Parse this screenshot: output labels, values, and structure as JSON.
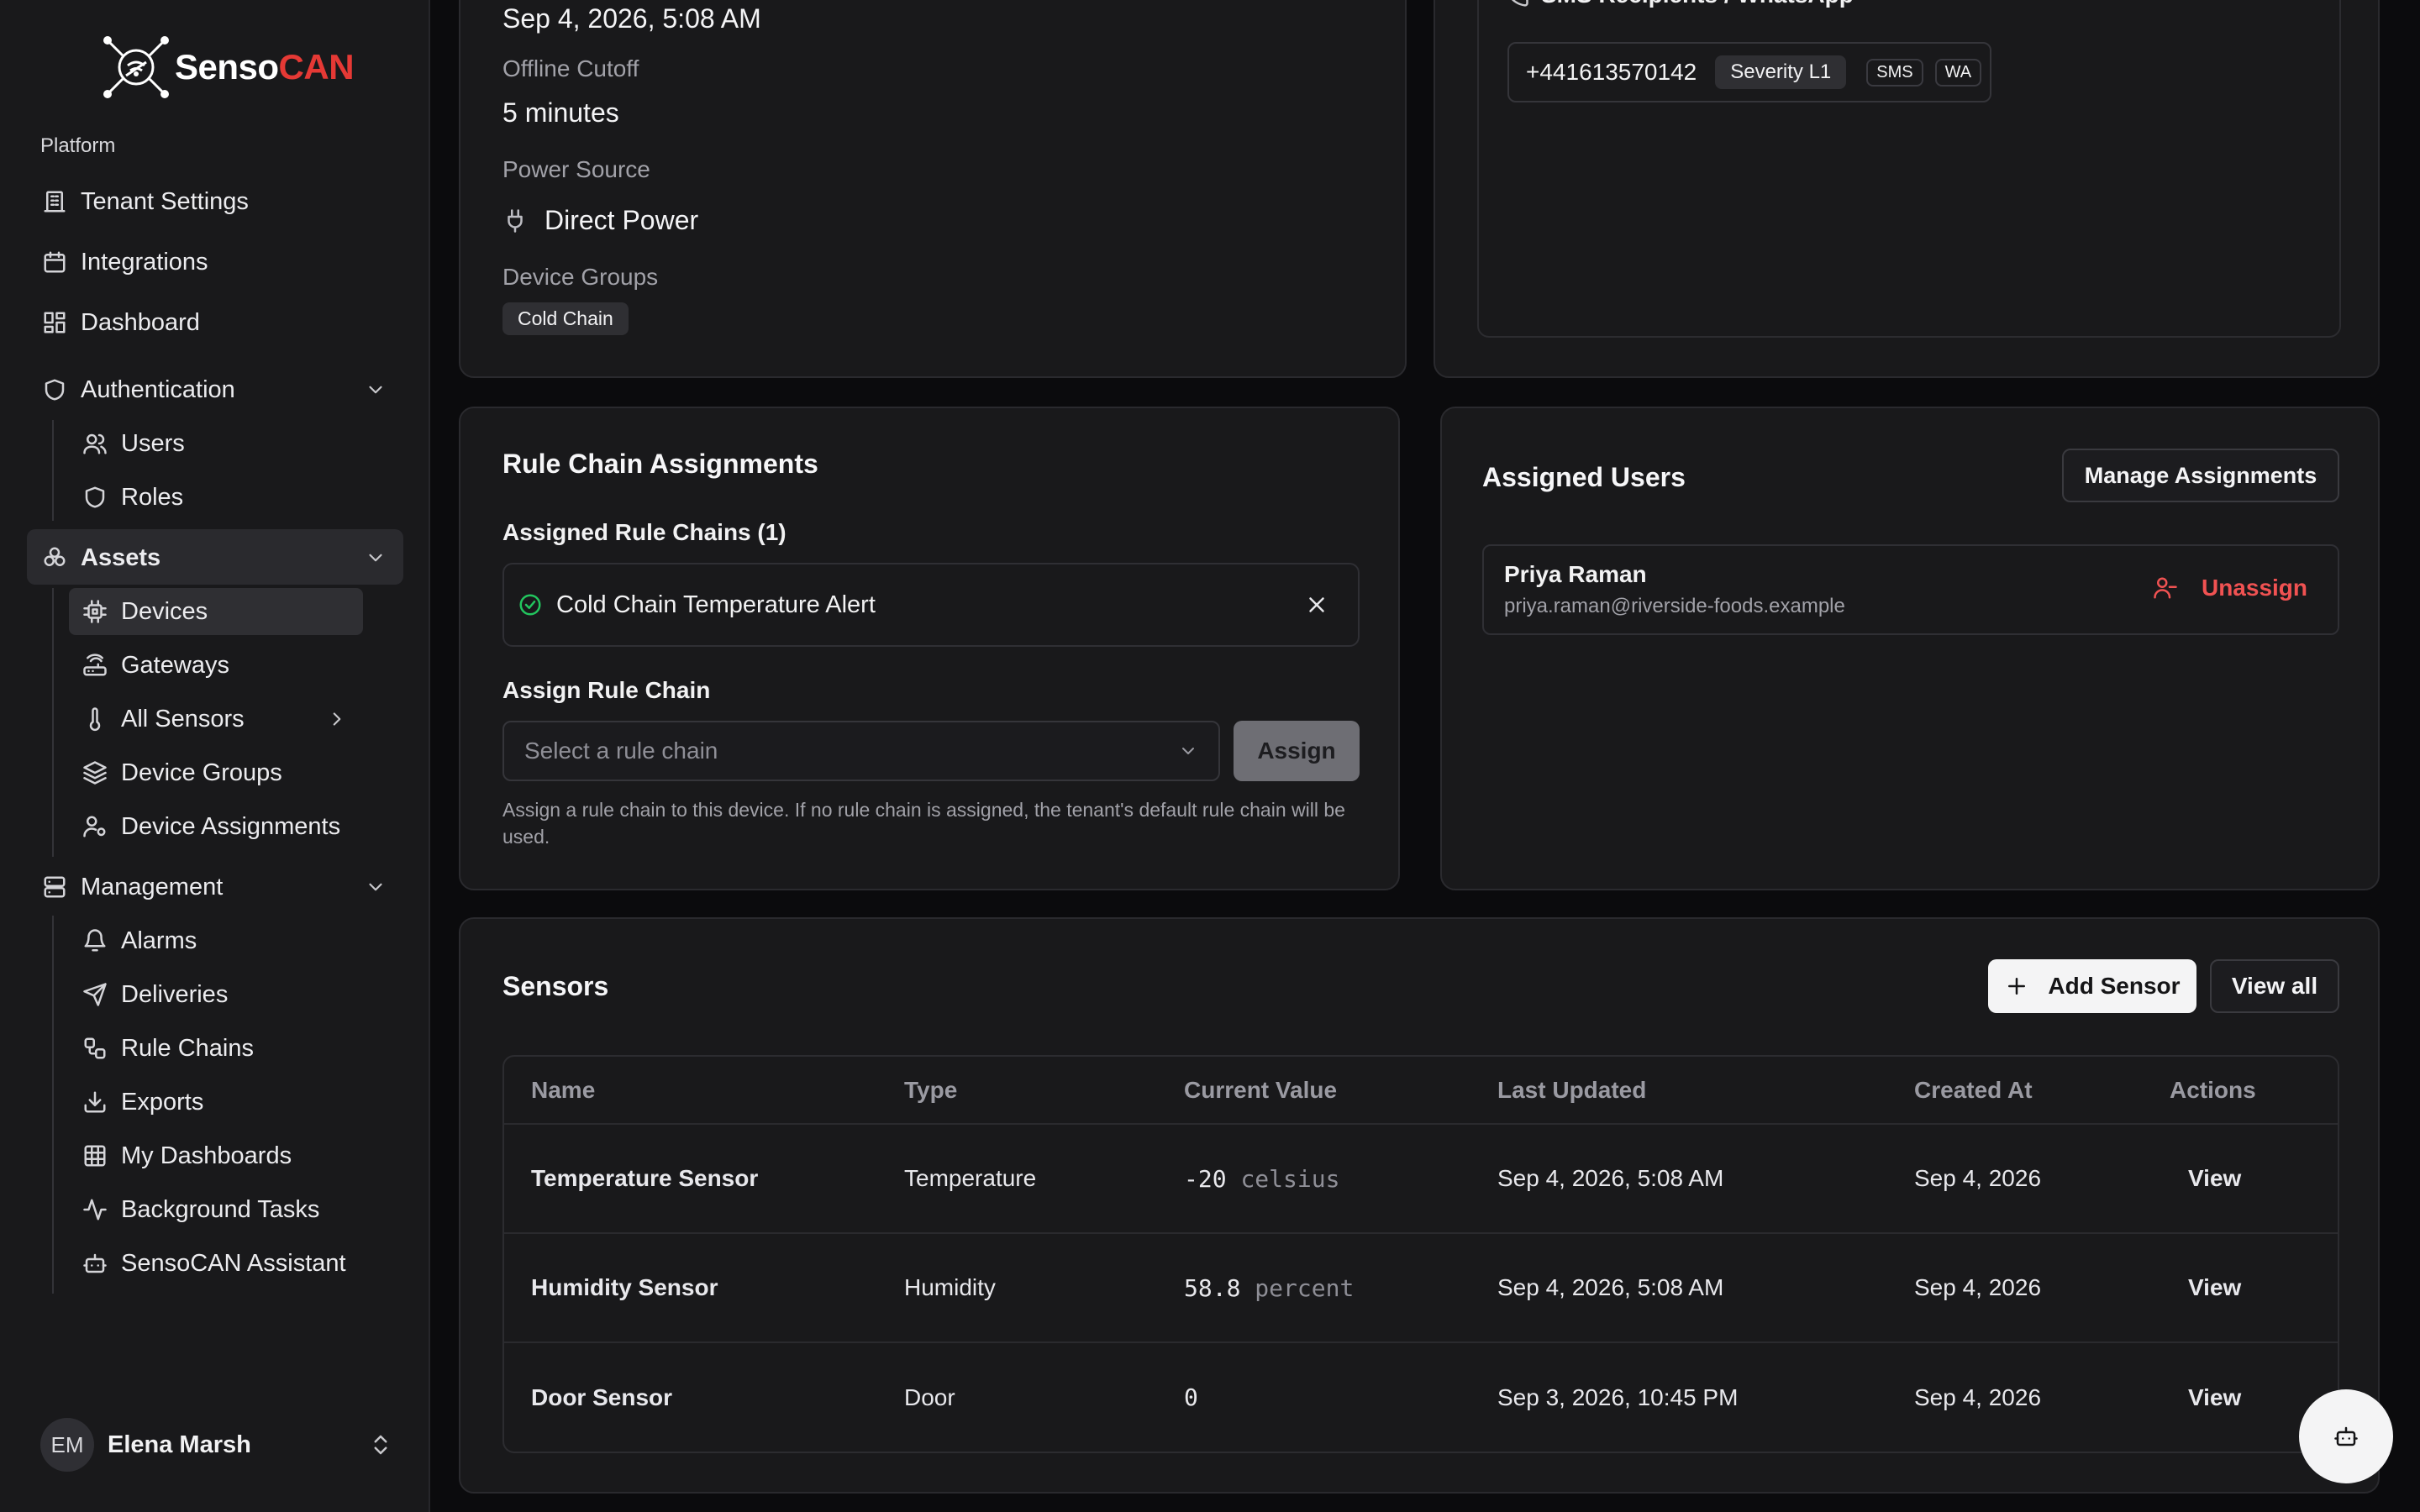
{
  "app": {
    "brand_part1": "Senso",
    "brand_part2": "CAN",
    "brand_colors": {
      "primary": "#ffffff",
      "accent": "#e53935"
    }
  },
  "sidebar": {
    "section_label": "Platform",
    "items": [
      {
        "label": "Tenant Settings",
        "icon": "building-icon"
      },
      {
        "label": "Integrations",
        "icon": "calendar-icon"
      },
      {
        "label": "Dashboard",
        "icon": "dashboard-icon"
      },
      {
        "label": "Authentication",
        "icon": "shield-icon",
        "expanded": true
      },
      {
        "label": "Users",
        "icon": "users-icon"
      },
      {
        "label": "Roles",
        "icon": "shield-icon"
      },
      {
        "label": "Assets",
        "icon": "assets-icon",
        "expanded": true,
        "active": true
      },
      {
        "label": "Devices",
        "icon": "chip-icon",
        "active": true
      },
      {
        "label": "Gateways",
        "icon": "router-icon"
      },
      {
        "label": "All Sensors",
        "icon": "thermometer-icon"
      },
      {
        "label": "Device Groups",
        "icon": "layers-icon"
      },
      {
        "label": "Device Assignments",
        "icon": "user-cog-icon"
      },
      {
        "label": "Management",
        "icon": "server-icon",
        "expanded": true
      },
      {
        "label": "Alarms",
        "icon": "bell-icon"
      },
      {
        "label": "Deliveries",
        "icon": "send-icon"
      },
      {
        "label": "Rule Chains",
        "icon": "workflow-icon"
      },
      {
        "label": "Exports",
        "icon": "download-icon"
      },
      {
        "label": "My Dashboards",
        "icon": "grid-icon"
      },
      {
        "label": "Background Tasks",
        "icon": "activity-icon"
      },
      {
        "label": "SensoCAN Assistant",
        "icon": "bot-icon"
      }
    ],
    "user": {
      "initials": "EM",
      "name": "Elena Marsh"
    }
  },
  "device_info": {
    "last_seen_value": "Sep 4, 2026, 5:08 AM",
    "offline_cutoff_label": "Offline Cutoff",
    "offline_cutoff_value": "5 minutes",
    "power_source_label": "Power Source",
    "power_source_value": "Direct Power",
    "device_groups_label": "Device Groups",
    "device_groups": [
      "Cold Chain"
    ]
  },
  "notifications": {
    "sms_header": "SMS Recipients / WhatsApp",
    "recipient": {
      "phone": "+441613570142",
      "severity": "Severity L1",
      "channels": [
        "SMS",
        "WA"
      ]
    }
  },
  "rule_chains": {
    "title": "Rule Chain Assignments",
    "assigned_label": "Assigned Rule Chains (1)",
    "assigned": [
      {
        "name": "Cold Chain Temperature Alert",
        "status_color": "#22c55e"
      }
    ],
    "assign_label": "Assign Rule Chain",
    "select_placeholder": "Select a rule chain",
    "assign_button": "Assign",
    "help_text": "Assign a rule chain to this device. If no rule chain is assigned, the tenant's default rule chain will be used."
  },
  "assigned_users": {
    "title": "Assigned Users",
    "manage_button": "Manage Assignments",
    "users": [
      {
        "name": "Priya Raman",
        "email": "priya.raman@riverside-foods.example",
        "action": "Unassign",
        "action_color": "#f05252"
      }
    ]
  },
  "sensors": {
    "title": "Sensors",
    "add_button": "Add Sensor",
    "view_all_button": "View all",
    "columns": [
      "Name",
      "Type",
      "Current Value",
      "Last Updated",
      "Created At",
      "Actions"
    ],
    "rows": [
      {
        "name": "Temperature Sensor",
        "type": "Temperature",
        "value": "-20",
        "unit": "celsius",
        "last_updated": "Sep 4, 2026, 5:08 AM",
        "created_at": "Sep 4, 2026",
        "action": "View"
      },
      {
        "name": "Humidity Sensor",
        "type": "Humidity",
        "value": "58.8",
        "unit": "percent",
        "last_updated": "Sep 4, 2026, 5:08 AM",
        "created_at": "Sep 4, 2026",
        "action": "View"
      },
      {
        "name": "Door Sensor",
        "type": "Door",
        "value": "0",
        "unit": "",
        "last_updated": "Sep 3, 2026, 10:45 PM",
        "created_at": "Sep 4, 2026",
        "action": "View"
      }
    ]
  },
  "assistant_fab": {
    "icon": "bot-icon"
  }
}
